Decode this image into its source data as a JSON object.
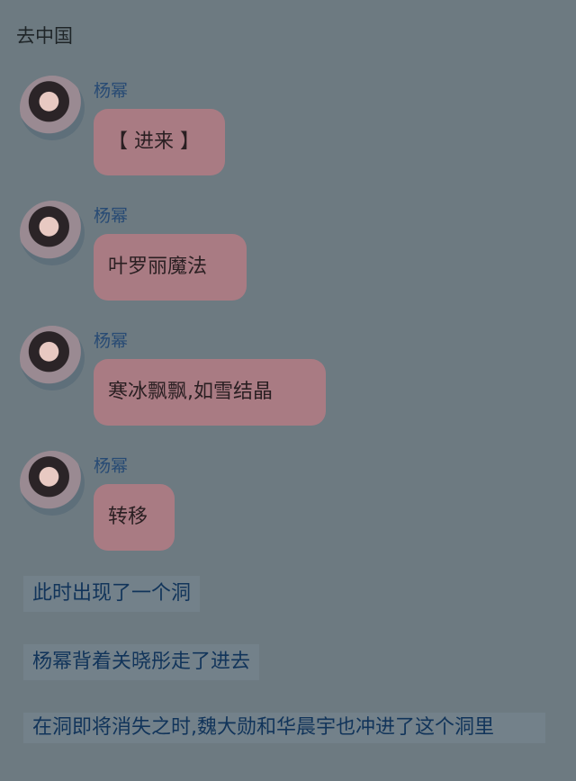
{
  "top_text": "去中国",
  "messages": [
    {
      "sender": "杨幂",
      "text": "【 进来 】"
    },
    {
      "sender": "杨幂",
      "text": "叶罗丽魔法"
    },
    {
      "sender": "杨幂",
      "text": "寒冰飘飘,如雪结晶"
    },
    {
      "sender": "杨幂",
      "text": "转移"
    }
  ],
  "narration": [
    "此时出现了一个洞",
    "杨幂背着关晓彤走了进去",
    "在洞即将消失之时,魏大勋和华晨宇也冲进了这个洞里"
  ]
}
